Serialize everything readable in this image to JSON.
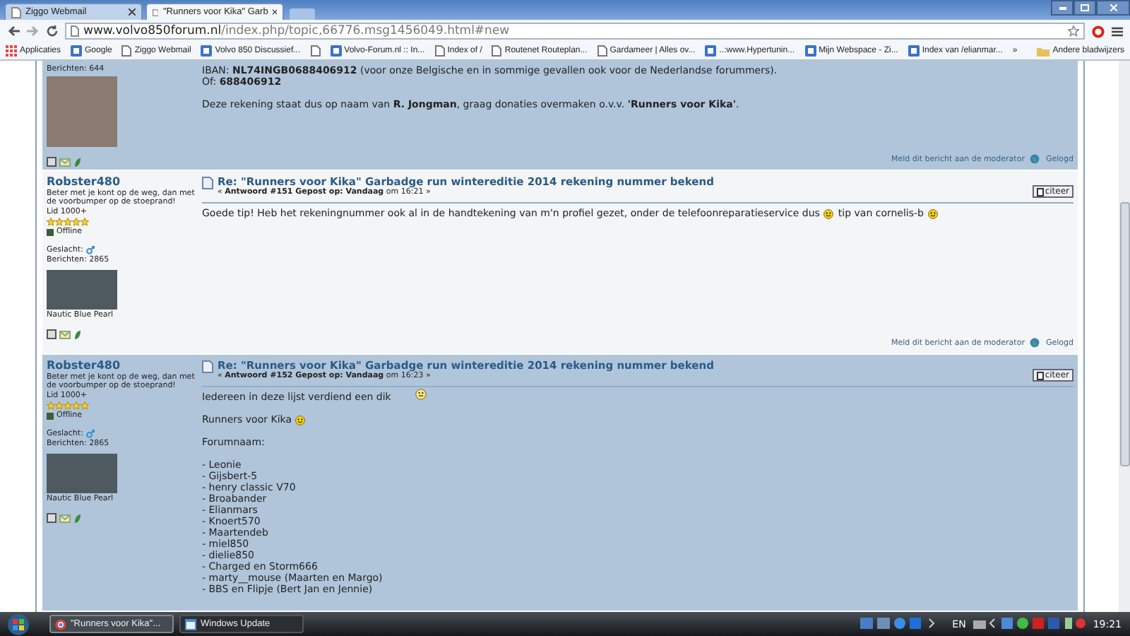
{
  "browser": {
    "tabs": [
      {
        "title": "Ziggo Webmail",
        "selected": false
      },
      {
        "title": "\"Runners voor Kika\" Garb",
        "selected": true
      }
    ],
    "url": {
      "host": "www.volvo850forum.nl",
      "path": "/index.php/topic,66776.msg1456049.html#new"
    },
    "bookmarks": [
      {
        "label": "Applicaties"
      },
      {
        "label": "Google"
      },
      {
        "label": "Ziggo Webmail"
      },
      {
        "label": "Volvo 850 Discussief..."
      },
      {
        "label": "Volvo-Forum.nl :: In..."
      },
      {
        "label": "Index of /"
      },
      {
        "label": "Routenet Routeplan..."
      },
      {
        "label": "Gardameer | Alles ov..."
      },
      {
        "label": "..:www.Hypertunin..."
      },
      {
        "label": "Mijn Webspace - Zi..."
      },
      {
        "label": "Index van /elianmar..."
      }
    ],
    "bookmarks_overflow": "»",
    "other_bookmarks": "Andere bladwijzers"
  },
  "posts": [
    {
      "poster": {
        "posts_count": "Berichten: 644"
      },
      "paragraphs": [
        {
          "lines": [
            [
              {
                "kind": "text",
                "text": "IBAN: **NL74INGB0688406912** (voor onze Belgische en in sommige gevallen ook voor de Nederlandse forummers)."
              }
            ],
            [
              {
                "kind": "text",
                "text": "Of: **688406912**"
              }
            ]
          ]
        },
        {
          "lines": [
            [
              {
                "kind": "text",
                "text": "Deze rekening staat dus op naam van **R. Jongman**, graag donaties overmaken o.v.v. **'Runners voor Kika'**."
              }
            ]
          ]
        }
      ],
      "report": "Meld dit bericht aan de moderator",
      "logged": "Gelogd"
    },
    {
      "poster": {
        "name": "Robster480",
        "title": "Beter met je kont op de weg, dan met de voorbumper op de stoeprand!",
        "rank": "Lid 1000+",
        "stars": 5,
        "status": "Offline",
        "gender": "Geslacht:",
        "posts_count": "Berichten: 2865",
        "signature": "Nautic Blue Pearl"
      },
      "subject": "Re: \"Runners voor Kika\" Garbadge run wintereditie 2014 rekening nummer bekend",
      "meta": "« **Antwoord #151 Gepost op: Vandaag** om 16:21 »",
      "quote": "citeer",
      "paragraphs": [
        {
          "lines": [
            [
              {
                "kind": "text",
                "text": "Goede tip! Heb het rekeningnummer ook al in de handtekening van m'n profiel gezet, onder de telefoonreparatieservice dus"
              },
              {
                "kind": "smiley"
              },
              {
                "kind": "text",
                "text": "tip van cornelis-b"
              },
              {
                "kind": "smiley"
              }
            ]
          ]
        }
      ],
      "report": "Meld dit bericht aan de moderator",
      "logged": "Gelogd"
    },
    {
      "poster": {
        "name": "Robster480",
        "title": "Beter met je kont op de weg, dan met de voorbumper op de stoeprand!",
        "rank": "Lid 1000+",
        "stars": 5,
        "status": "Offline",
        "gender": "Geslacht:",
        "posts_count": "Berichten: 2865",
        "signature": "Nautic Blue Pearl"
      },
      "subject": "Re: \"Runners voor Kika\" Garbadge run wintereditie 2014 rekening nummer bekend",
      "meta": "« **Antwoord #152 Gepost op: Vandaag** om 16:23 »",
      "quote": "citeer",
      "paragraphs": [
        {
          "lines": [
            [
              {
                "kind": "text",
                "text": "Iedereen in deze lijst verdiend een dik"
              },
              {
                "kind": "thumb"
              }
            ]
          ]
        },
        {
          "lines": [
            [
              {
                "kind": "text",
                "text": "Runners voor Kika"
              },
              {
                "kind": "smiley"
              }
            ]
          ]
        },
        {
          "lines": [
            [
              {
                "kind": "text",
                "text": "Forumnaam:"
              }
            ]
          ]
        },
        {
          "lines": [
            [
              {
                "kind": "text",
                "text": "- Leonie"
              }
            ],
            [
              {
                "kind": "text",
                "text": "- Gijsbert-5"
              }
            ],
            [
              {
                "kind": "text",
                "text": "- henry classic V70"
              }
            ],
            [
              {
                "kind": "text",
                "text": "- Broabander"
              }
            ],
            [
              {
                "kind": "text",
                "text": "- Elianmars"
              }
            ],
            [
              {
                "kind": "text",
                "text": "- Knoert570"
              }
            ],
            [
              {
                "kind": "text",
                "text": "- Maartendeb"
              }
            ],
            [
              {
                "kind": "text",
                "text": "- miel850"
              }
            ],
            [
              {
                "kind": "text",
                "text": "- dielie850"
              }
            ],
            [
              {
                "kind": "text",
                "text": "- Charged en Storm666"
              }
            ],
            [
              {
                "kind": "text",
                "text": "- marty__mouse (Maarten en Margo)"
              }
            ],
            [
              {
                "kind": "text",
                "text": "- BBS en Flipje (Bert Jan en Jennie)"
              }
            ]
          ]
        }
      ]
    }
  ],
  "taskbar": {
    "tasks": [
      {
        "label": "\"Runners voor Kika\"...",
        "selected": true
      },
      {
        "label": "Windows Update",
        "selected": false
      }
    ],
    "language": "EN",
    "clock": "19:21"
  }
}
